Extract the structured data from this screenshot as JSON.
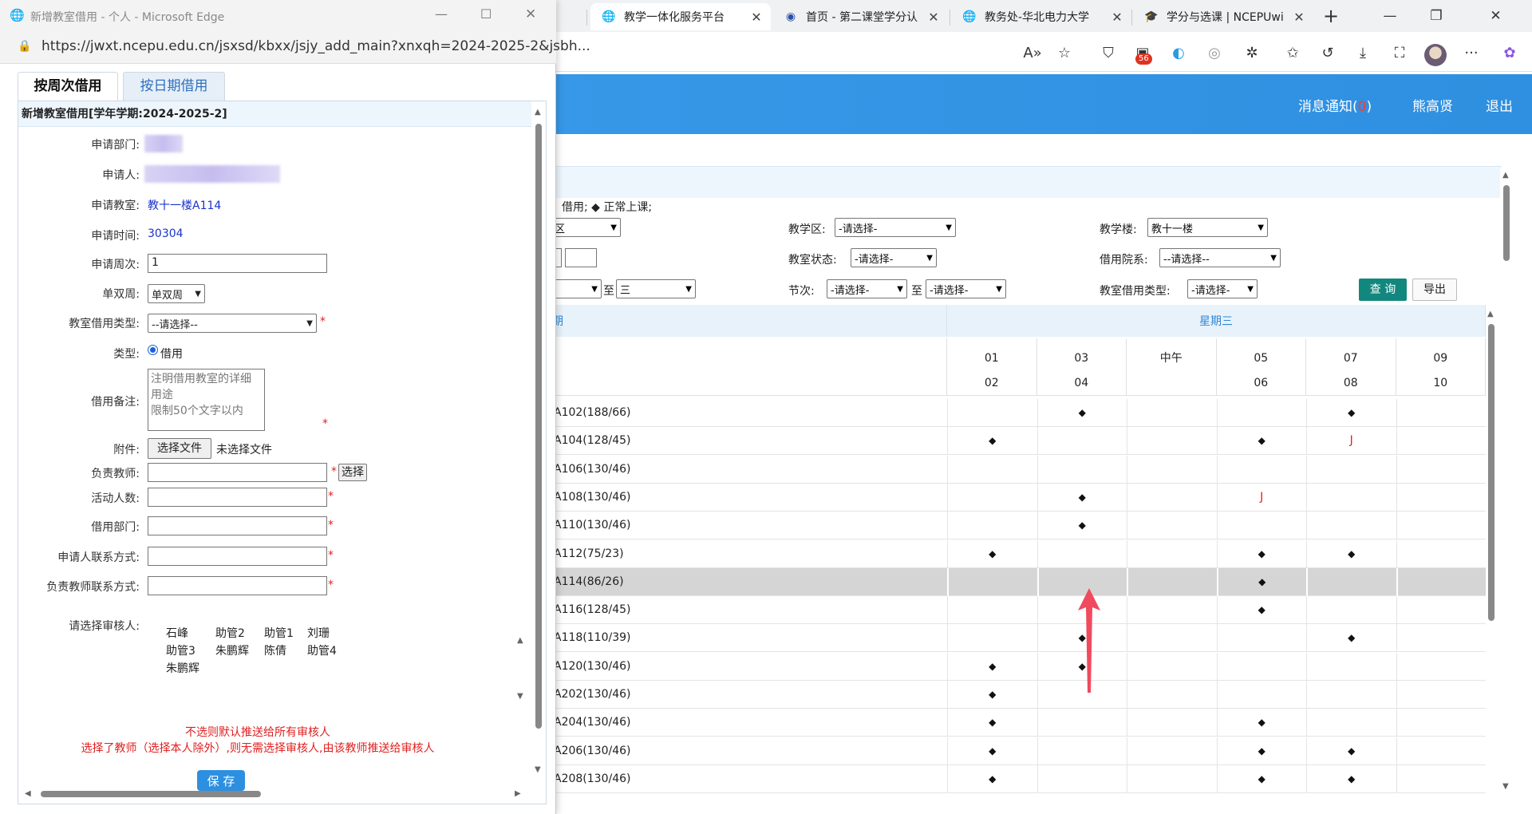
{
  "browser": {
    "tabs": [
      {
        "label": "教学一体化服务平台",
        "icon": "globe-icon",
        "active": true
      },
      {
        "label": "首页 - 第二课堂学分认",
        "icon": "school-badge-icon",
        "active": false
      },
      {
        "label": "教务处-华北电力大学",
        "icon": "globe-icon",
        "active": false
      },
      {
        "label": "学分与选课 | NCEPUwi",
        "icon": "graduation-cap-icon",
        "active": false
      }
    ],
    "extension_badge": "56"
  },
  "header": {
    "messages_label": "消息通知(",
    "messages_count": "0",
    "messages_close": ")",
    "user_name": "熊高贤",
    "logout_label": "退出"
  },
  "legend_text": "借用; ◆ 正常上课;",
  "query": {
    "campus_value": "区",
    "teaching_area_label": "教学区:",
    "teaching_area_value": "-请选择-",
    "building_label": "教学楼:",
    "building_value": "教十一楼",
    "room_status_label": "教室状态:",
    "room_status_value": "-请选择-",
    "borrow_dept_label": "借用院系:",
    "borrow_dept_value": "--请选择--",
    "weekday_to": "至",
    "weekday_end_value": "三",
    "section_label": "节次:",
    "section_start_value": "-请选择-",
    "section_to": "至",
    "section_end_value": "-请选择-",
    "borrow_type_label": "教室借用类型:",
    "borrow_type_value": "-请选择-",
    "query_button": "查 询",
    "export_button": "导出"
  },
  "schedule": {
    "prev_day_header": "期",
    "day_header": "星期三",
    "periods": [
      {
        "top": "01",
        "bottom": "02"
      },
      {
        "top": "03",
        "bottom": "04"
      },
      {
        "top": "中午",
        "bottom": ""
      },
      {
        "top": "05",
        "bottom": "06"
      },
      {
        "top": "07",
        "bottom": "08"
      },
      {
        "top": "09",
        "bottom": "10"
      }
    ],
    "rows": [
      {
        "room": "A102(188/66)",
        "slots": [
          "",
          "◆",
          "",
          "",
          "◆",
          ""
        ]
      },
      {
        "room": "A104(128/45)",
        "slots": [
          "◆",
          "",
          "",
          "◆",
          "J",
          ""
        ]
      },
      {
        "room": "A106(130/46)",
        "slots": [
          "",
          "",
          "",
          "",
          "",
          ""
        ]
      },
      {
        "room": "A108(130/46)",
        "slots": [
          "",
          "◆",
          "",
          "J",
          "",
          ""
        ]
      },
      {
        "room": "A110(130/46)",
        "slots": [
          "",
          "◆",
          "",
          "",
          "",
          ""
        ]
      },
      {
        "room": "A112(75/23)",
        "slots": [
          "◆",
          "",
          "",
          "◆",
          "◆",
          ""
        ]
      },
      {
        "room": "A114(86/26)",
        "slots": [
          "",
          "",
          "",
          "◆",
          "",
          ""
        ],
        "highlight": true
      },
      {
        "room": "A116(128/45)",
        "slots": [
          "",
          "",
          "",
          "◆",
          "",
          ""
        ]
      },
      {
        "room": "A118(110/39)",
        "slots": [
          "",
          "◆",
          "",
          "",
          "◆",
          ""
        ]
      },
      {
        "room": "A120(130/46)",
        "slots": [
          "◆",
          "◆",
          "",
          "",
          "",
          ""
        ]
      },
      {
        "room": "A202(130/46)",
        "slots": [
          "◆",
          "",
          "",
          "",
          "",
          ""
        ]
      },
      {
        "room": "A204(130/46)",
        "slots": [
          "◆",
          "",
          "",
          "◆",
          "",
          ""
        ]
      },
      {
        "room": "A206(130/46)",
        "slots": [
          "◆",
          "",
          "",
          "◆",
          "◆",
          ""
        ]
      },
      {
        "room": "A208(130/46)",
        "slots": [
          "◆",
          "",
          "",
          "◆",
          "◆",
          ""
        ]
      }
    ]
  },
  "popup": {
    "title": "新增教室借用 - 个人 - Microsoft Edge",
    "url": "https://jwxt.ncepu.edu.cn/jsxsd/kbxx/jsjy_add_main?xnxqh=2024-2025-2&jsbh...",
    "tab_week": "按周次借用",
    "tab_date": "按日期借用",
    "form_header": "新增教室借用[学年学期:2024-2025-2]",
    "dept_label": "申请部门:",
    "applicant_label": "申请人:",
    "room_label": "申请教室:",
    "room_value": "教十一楼A114",
    "time_label": "申请时间:",
    "time_value": "30304",
    "week_label": "申请周次:",
    "week_value": "1",
    "parity_label": "单双周:",
    "parity_value": "单双周",
    "borrow_type_label": "教室借用类型:",
    "borrow_type_value": "--请选择--",
    "kind_label": "类型:",
    "kind_value": "借用",
    "remark_label": "借用备注:",
    "remark_placeholder_1": "注明借用教室的详细用途",
    "remark_placeholder_2": "限制50个文字以内",
    "attachment_label": "附件:",
    "file_button": "选择文件",
    "no_file_text": "未选择文件",
    "teacher_label": "负责教师:",
    "pick_button": "选择",
    "headcount_label": "活动人数:",
    "borrow_dept_label": "借用部门:",
    "applicant_contact_label": "申请人联系方式:",
    "teacher_contact_label": "负责教师联系方式:",
    "approver_label": "请选择审核人:",
    "approvers": [
      "石峰",
      "助管2",
      "助管1",
      "刘珊",
      "助管3",
      "朱鹏辉",
      "陈倩",
      "助管4",
      "朱鹏辉"
    ],
    "note_1": "不选则默认推送给所有审核人",
    "note_2": "选择了教师（选择本人除外）,则无需选择审核人,由该教师推送给审核人",
    "save_button": "保 存",
    "required_mark": "*"
  }
}
